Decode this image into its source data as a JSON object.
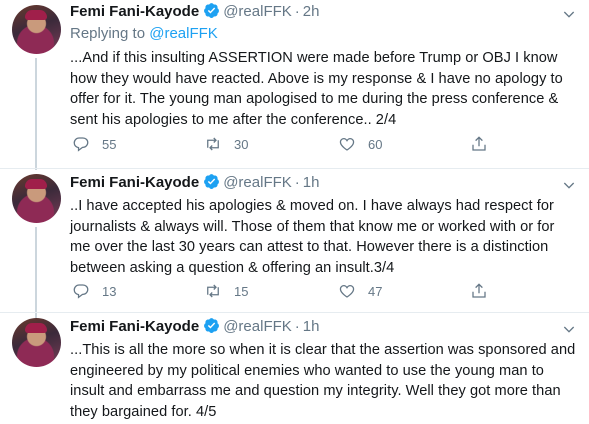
{
  "tweets": [
    {
      "name": "Femi Fani-Kayode",
      "handle": "@realFFK",
      "dot": "·",
      "time": "2h",
      "reply_prefix": "Replying to ",
      "reply_handle": "@realFFK",
      "text": "...And if this insulting ASSERTION were made before Trump or OBJ I know how they would have reacted. Above is my response & I have no apology to offer for it. The young man apologised to me during the press conference & sent his apologies to me after the conference.. 2/4",
      "replies": "55",
      "retweets": "30",
      "likes": "60"
    },
    {
      "name": "Femi Fani-Kayode",
      "handle": "@realFFK",
      "dot": "·",
      "time": "1h",
      "text": "..I have accepted his apologies & moved on. I have always had respect for journalists & always will. Those of them that know me or worked with or for me over the last 30 years can attest to that. However there is a distinction between asking a question & offering an insult.3/4",
      "replies": "13",
      "retweets": "15",
      "likes": "47"
    },
    {
      "name": "Femi Fani-Kayode",
      "handle": "@realFFK",
      "dot": "·",
      "time": "1h",
      "text": "...This is all the more so when it is clear that the assertion was sponsored and engineered by my political enemies who wanted to use the young man to insult and embarrass me and question my integrity. Well they got more than they bargained for. 4/5"
    }
  ],
  "icons": {
    "verified": "verified-badge-icon",
    "chevron": "chevron-down-icon",
    "reply": "reply-icon",
    "retweet": "retweet-icon",
    "like": "heart-icon",
    "share": "share-icon"
  },
  "colors": {
    "verified": "#1da1f2",
    "link": "#1da1f2",
    "muted": "#657786",
    "thread_line": "#ccd6dd"
  }
}
